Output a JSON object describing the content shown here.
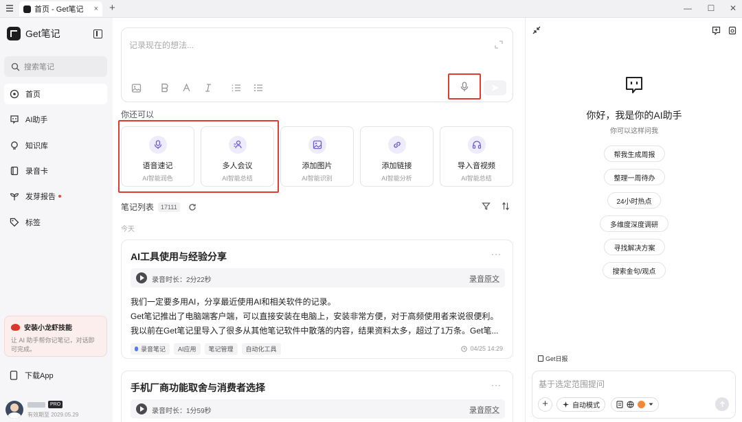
{
  "titlebar": {
    "tab_title": "首页 - Get笔记",
    "tab_close": "×",
    "new_tab": "+",
    "minimize": "—",
    "maximize": "☐",
    "close": "✕"
  },
  "sidebar": {
    "brand": "Get笔记",
    "search_placeholder": "搜索笔记",
    "items": [
      {
        "label": "首页",
        "icon": "home-icon"
      },
      {
        "label": "AI助手",
        "icon": "bot-icon"
      },
      {
        "label": "知识库",
        "icon": "lightbulb-icon"
      },
      {
        "label": "录音卡",
        "icon": "card-icon"
      },
      {
        "label": "发芽报告",
        "icon": "sprout-icon"
      },
      {
        "label": "标签",
        "icon": "tag-icon"
      }
    ],
    "promo": {
      "title": "安装小龙虾技能",
      "desc": "让 AI 助手帮你记笔记，对话即可完成。"
    },
    "download": "下载App",
    "user": {
      "badge": "PRO",
      "expiry": "有效期至 2029.05.29"
    }
  },
  "editor": {
    "placeholder": "记录现在的想法..."
  },
  "quick": {
    "heading": "你还可以",
    "cards": [
      {
        "title": "语音速记",
        "sub": "AI智能润色",
        "icon": "mic-icon"
      },
      {
        "title": "多人会议",
        "sub": "AI智能总结",
        "icon": "meeting-icon"
      },
      {
        "title": "添加图片",
        "sub": "AI智能识别",
        "icon": "image-icon"
      },
      {
        "title": "添加链接",
        "sub": "AI智能分析",
        "icon": "link-icon"
      },
      {
        "title": "导入音视频",
        "sub": "AI智能总结",
        "icon": "headphones-icon"
      }
    ]
  },
  "list": {
    "title": "笔记列表",
    "count": "17111",
    "today": "今天"
  },
  "notes": [
    {
      "title": "AI工具使用与经验分享",
      "duration": "录音时长：2分22秒",
      "original": "录音原文",
      "lines": [
        "我们一定要多用AI，分享最近使用AI和相关软件的记录。",
        "Get笔记推出了电脑端客户端，可以直接安装在电脑上，安装非常方便，对于高频使用者来说很便利。",
        "我以前在Get笔记里导入了很多从其他笔记软件中散落的内容，结果资料太多，超过了1万条。Get笔..."
      ],
      "tags": [
        "录音笔记",
        "AI应用",
        "笔记管理",
        "自动化工具"
      ],
      "date": "04/25 14:29"
    },
    {
      "title": "手机厂商功能取舍与消费者选择",
      "duration": "录音时长：1分59秒",
      "original": "录音原文"
    }
  ],
  "assistant": {
    "greeting": "你好，我是你的AI助手",
    "sub": "你可以这样问我",
    "suggestions": [
      "帮我生成周报",
      "整理一周待办",
      "24小时热点",
      "多维度深度调研",
      "寻找解决方案",
      "搜索金句/观点"
    ],
    "daily": "Get日报",
    "input_placeholder": "基于选定范围提问",
    "mode": "自动模式"
  },
  "colors": {
    "highlight_red": "#e03a32",
    "accent_purple": "#6d5bd0",
    "sidebar_bg": "#f6f6f8"
  }
}
